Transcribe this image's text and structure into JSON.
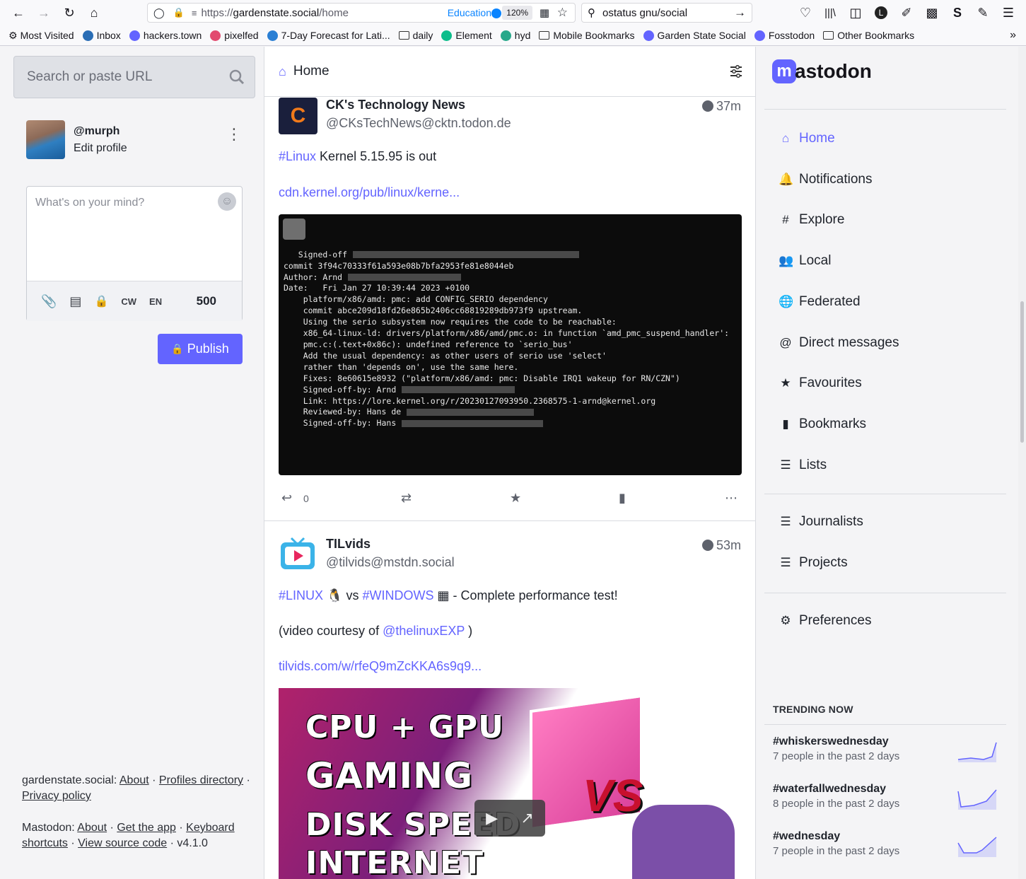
{
  "browser": {
    "url_prefix": "https://",
    "url_host": "gardenstate.social",
    "url_path": "/home",
    "container_label": "Education",
    "zoom": "120%",
    "search_text": "ostatus gnu/social",
    "bookmarks": [
      {
        "label": "Most Visited",
        "kind": "gear",
        "color": "#333333"
      },
      {
        "label": "Inbox",
        "kind": "icon",
        "color": "#2a6db5"
      },
      {
        "label": "hackers.town",
        "kind": "icon",
        "color": "#6364ff"
      },
      {
        "label": "pixelfed",
        "kind": "icon",
        "color": "#e24b6f"
      },
      {
        "label": "7-Day Forecast for Lati...",
        "kind": "icon",
        "color": "#2a7fd4"
      },
      {
        "label": "daily",
        "kind": "folder",
        "color": "#333333"
      },
      {
        "label": "Element",
        "kind": "icon",
        "color": "#0dbd8b"
      },
      {
        "label": "hyd",
        "kind": "icon",
        "color": "#27a88a"
      },
      {
        "label": "Mobile Bookmarks",
        "kind": "folder",
        "color": "#333333"
      },
      {
        "label": "Garden State Social",
        "kind": "icon",
        "color": "#6364ff"
      },
      {
        "label": "Fosstodon",
        "kind": "icon",
        "color": "#6364ff"
      },
      {
        "label": "Other Bookmarks",
        "kind": "folder",
        "color": "#333333"
      }
    ]
  },
  "left": {
    "search_placeholder": "Search or paste URL",
    "profile": {
      "handle": "@murph",
      "edit_label": "Edit profile"
    },
    "compose": {
      "placeholder": "What's on your mind?",
      "cw": "CW",
      "lang": "EN",
      "count": "500",
      "publish": "Publish"
    },
    "footer": {
      "site": "gardenstate.social",
      "about": "About",
      "profiles": "Profiles directory",
      "privacy": "Privacy policy",
      "mastodon": "Mastodon",
      "about2": "About",
      "get_app": "Get the app",
      "keyboard": "Keyboard",
      "shortcuts": "shortcuts",
      "source": "View source code",
      "version": "v4.1.0"
    }
  },
  "center": {
    "title": "Home",
    "posts": [
      {
        "name": "CK's Technology News",
        "acct": "@CKsTechNews@cktn.todon.de",
        "time": "37m",
        "hashtag": "#Linux",
        "text": " Kernel 5.15.95 is out",
        "link": "cdn.kernel.org/pub/linux/kerne...",
        "terminal": [
          "   Signed-off",
          "",
          "commit 3f94c70333f61a593e08b7bfa2953fe81e8044eb",
          "Author: Arnd",
          "Date:   Fri Jan 27 10:39:44 2023 +0100",
          "",
          "    platform/x86/amd: pmc: add CONFIG_SERIO dependency",
          "",
          "    commit abce209d18fd26e865b2406cc68819289db973f9 upstream.",
          "",
          "    Using the serio subsystem now requires the code to be reachable:",
          "",
          "    x86_64-linux-ld: drivers/platform/x86/amd/pmc.o: in function `amd_pmc_suspend_handler':",
          "    pmc.c:(.text+0x86c): undefined reference to `serio_bus'",
          "",
          "    Add the usual dependency: as other users of serio use 'select'",
          "    rather than 'depends on', use the same here.",
          "",
          "    Fixes: 8e60615e8932 (\"platform/x86/amd: pmc: Disable IRQ1 wakeup for RN/CZN\")",
          "    Signed-off-by: Arnd",
          "    Link: https://lore.kernel.org/r/20230127093950.2368575-1-arnd@kernel.org",
          "    Reviewed-by: Hans de",
          "    Signed-off-by: Hans"
        ],
        "replies": "0"
      },
      {
        "name": "TILvids",
        "acct": "@tilvids@mstdn.social",
        "time": "53m",
        "tag1": "#LINUX",
        "mid": " vs ",
        "tag2": "#WINDOWS",
        "tail": " - Complete performance test!",
        "credit_pre": "(video courtesy of ",
        "credit_link": "@thelinuxEXP",
        "credit_post": " )",
        "link": "tilvids.com/w/rfeQ9mZcKKA6s9q9...",
        "thumb_lines": [
          "CPU + GPU",
          "GAMING",
          "DISK SPEED",
          "INTERNET"
        ],
        "thumb_vs": "VS"
      }
    ]
  },
  "right": {
    "logo_text": "astodon",
    "nav": [
      {
        "label": "Home",
        "icon": "home-icon"
      },
      {
        "label": "Notifications",
        "icon": "bell-icon"
      },
      {
        "label": "Explore",
        "icon": "hashtag-icon"
      },
      {
        "label": "Local",
        "icon": "users-icon"
      },
      {
        "label": "Federated",
        "icon": "globe-icon"
      },
      {
        "label": "Direct messages",
        "icon": "at-icon"
      },
      {
        "label": "Favourites",
        "icon": "star-icon"
      },
      {
        "label": "Bookmarks",
        "icon": "bookmark-icon"
      },
      {
        "label": "Lists",
        "icon": "list-icon"
      }
    ],
    "lists": [
      {
        "label": "Journalists"
      },
      {
        "label": "Projects"
      }
    ],
    "preferences": "Preferences",
    "trending_title": "TRENDING NOW",
    "trends": [
      {
        "tag": "#whiskerswednesday",
        "sub": "7 people in the past 2 days"
      },
      {
        "tag": "#waterfallwednesday",
        "sub": "8 people in the past 2 days"
      },
      {
        "tag": "#wednesday",
        "sub": "7 people in the past 2 days"
      }
    ]
  }
}
